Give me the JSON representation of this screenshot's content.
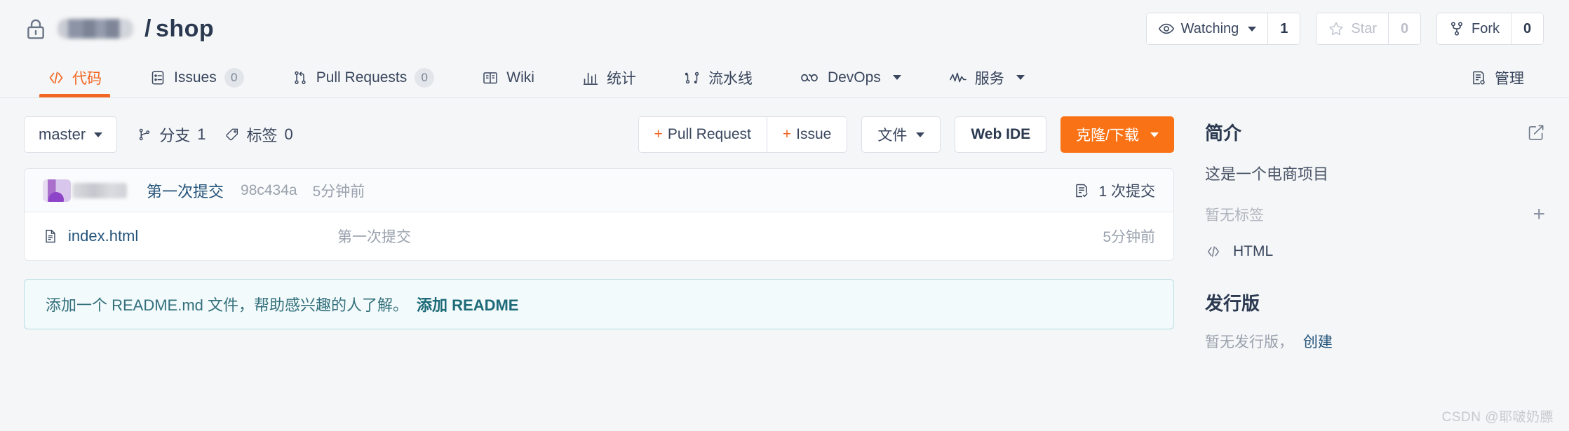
{
  "header": {
    "lock_icon": "lock-icon",
    "owner_redacted": "",
    "separator": "/",
    "repo_name": "shop",
    "watching": {
      "label": "Watching",
      "count": "1",
      "icon": "eye-icon"
    },
    "star": {
      "label": "Star",
      "count": "0",
      "icon": "star-icon"
    },
    "fork": {
      "label": "Fork",
      "count": "0",
      "icon": "fork-icon"
    }
  },
  "tabs": [
    {
      "label": "代码",
      "icon": "code-icon",
      "badge": null,
      "active": true,
      "dropdown": false
    },
    {
      "label": "Issues",
      "icon": "issue-icon",
      "badge": "0",
      "active": false,
      "dropdown": false
    },
    {
      "label": "Pull Requests",
      "icon": "pull-request-icon",
      "badge": "0",
      "active": false,
      "dropdown": false
    },
    {
      "label": "Wiki",
      "icon": "book-icon",
      "badge": null,
      "active": false,
      "dropdown": false
    },
    {
      "label": "统计",
      "icon": "chart-icon",
      "badge": null,
      "active": false,
      "dropdown": false
    },
    {
      "label": "流水线",
      "icon": "pipeline-icon",
      "badge": null,
      "active": false,
      "dropdown": false
    },
    {
      "label": "DevOps",
      "icon": "infinity-icon",
      "badge": null,
      "active": false,
      "dropdown": true
    },
    {
      "label": "服务",
      "icon": "activity-icon",
      "badge": null,
      "active": false,
      "dropdown": true
    },
    {
      "label": "管理",
      "icon": "settings-doc-icon",
      "badge": null,
      "active": false,
      "dropdown": false
    }
  ],
  "toolbar": {
    "branch": "master",
    "branches_label": "分支",
    "branches_count": "1",
    "tags_label": "标签",
    "tags_count": "0",
    "new_pull_request": "Pull Request",
    "new_issue": "Issue",
    "plus_sign": "+",
    "files_label": "文件",
    "web_ide_label": "Web IDE",
    "clone_label": "克隆/下载"
  },
  "commit": {
    "author_redacted": "",
    "message": "第一次提交",
    "hash": "98c434a",
    "time": "5分钟前",
    "count_label": "1 次提交",
    "count_icon": "commit-history-icon"
  },
  "files": [
    {
      "name": "index.html",
      "icon": "file-icon",
      "commit_message": "第一次提交",
      "time": "5分钟前"
    }
  ],
  "readme_banner": {
    "text": "添加一个 README.md 文件，帮助感兴趣的人了解。",
    "link_label": "添加 README"
  },
  "sidebar": {
    "intro_title": "简介",
    "edit_icon": "edit-icon",
    "description": "这是一个电商项目",
    "tags_empty": "暂无标签",
    "add_tag_icon": "plus-icon",
    "language": "HTML",
    "language_icon": "code-icon",
    "releases_title": "发行版",
    "releases_empty": "暂无发行版，",
    "releases_link": "创建"
  },
  "watermark": "CSDN @耶啵奶膘",
  "colors": {
    "accent_orange": "#f26522",
    "primary_button": "#f97316",
    "link_blue": "#22527a",
    "banner_border": "#b9dde2",
    "banner_bg": "#f2fafb",
    "page_bg": "#f5f6f7"
  }
}
